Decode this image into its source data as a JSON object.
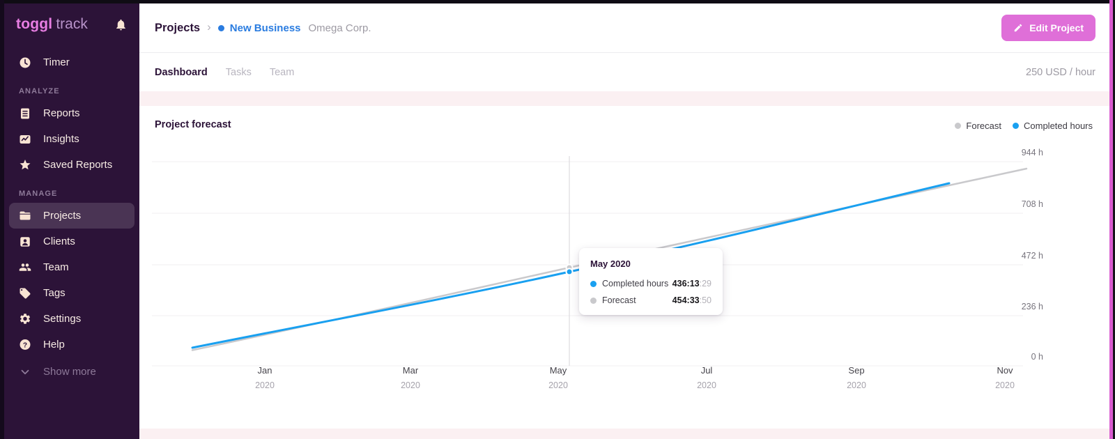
{
  "sidebar": {
    "logo_bold": "toggl",
    "logo_light": "track",
    "timer": {
      "label": "Timer"
    },
    "analyze_header": "ANALYZE",
    "analyze_items": [
      {
        "label": "Reports"
      },
      {
        "label": "Insights"
      },
      {
        "label": "Saved Reports"
      }
    ],
    "manage_header": "MANAGE",
    "manage_items": [
      {
        "label": "Projects"
      },
      {
        "label": "Clients"
      },
      {
        "label": "Team"
      },
      {
        "label": "Tags"
      },
      {
        "label": "Settings"
      },
      {
        "label": "Help"
      }
    ],
    "show_more": "Show more"
  },
  "header": {
    "breadcrumb_root": "Projects",
    "breadcrumb_chevron": "›",
    "project_name": "New Business",
    "client_name": "Omega Corp.",
    "edit_button": "Edit Project"
  },
  "tabs": {
    "dashboard": "Dashboard",
    "tasks": "Tasks",
    "team": "Team",
    "rate": "250 USD / hour"
  },
  "card": {
    "title": "Project forecast"
  },
  "legend": {
    "forecast_label": "Forecast",
    "completed_label": "Completed hours"
  },
  "tooltip": {
    "title": "May 2020",
    "rows": [
      {
        "label": "Completed hours",
        "value_main": "436:13",
        "value_sub": ":29",
        "color": "#19a0f0"
      },
      {
        "label": "Forecast",
        "value_main": "454:33",
        "value_sub": ":50",
        "color": "#c9c9cc"
      }
    ]
  },
  "colors": {
    "completed_blue": "#19a0f0",
    "forecast_gray": "#c9c9cc",
    "accent_pink": "#df6fd8",
    "sidebar_purple": "#2c1338",
    "link_blue": "#2a7ce0"
  },
  "chart_data": {
    "type": "line",
    "title": "Project forecast",
    "x_ticks": [
      {
        "month": "Jan",
        "year": "2020"
      },
      {
        "month": "Mar",
        "year": "2020"
      },
      {
        "month": "May",
        "year": "2020"
      },
      {
        "month": "Jul",
        "year": "2020"
      },
      {
        "month": "Sep",
        "year": "2020"
      },
      {
        "month": "Nov",
        "year": "2020"
      }
    ],
    "y_ticks_top_down": [
      "944 h",
      "708 h",
      "472 h",
      "236 h",
      "0 h"
    ],
    "ylim": [
      0,
      944
    ],
    "grid": true,
    "legend_position": "top-right",
    "series": [
      {
        "name": "Forecast",
        "color": "#c9c9cc",
        "points": [
          {
            "x": "Dec 2019",
            "hours": 80
          },
          {
            "x": "May 2020",
            "hours": 454.56
          },
          {
            "x": "Nov 2020",
            "hours": 912
          }
        ]
      },
      {
        "name": "Completed hours",
        "color": "#19a0f0",
        "points": [
          {
            "x": "Dec 2019",
            "hours": 80
          },
          {
            "x": "May 2020",
            "hours": 436.22
          },
          {
            "x": "Oct 2020",
            "hours": 844
          }
        ]
      }
    ],
    "highlight": {
      "x": "May 2020",
      "completed_hours": "436:13:29",
      "forecast": "454:33:50"
    }
  }
}
